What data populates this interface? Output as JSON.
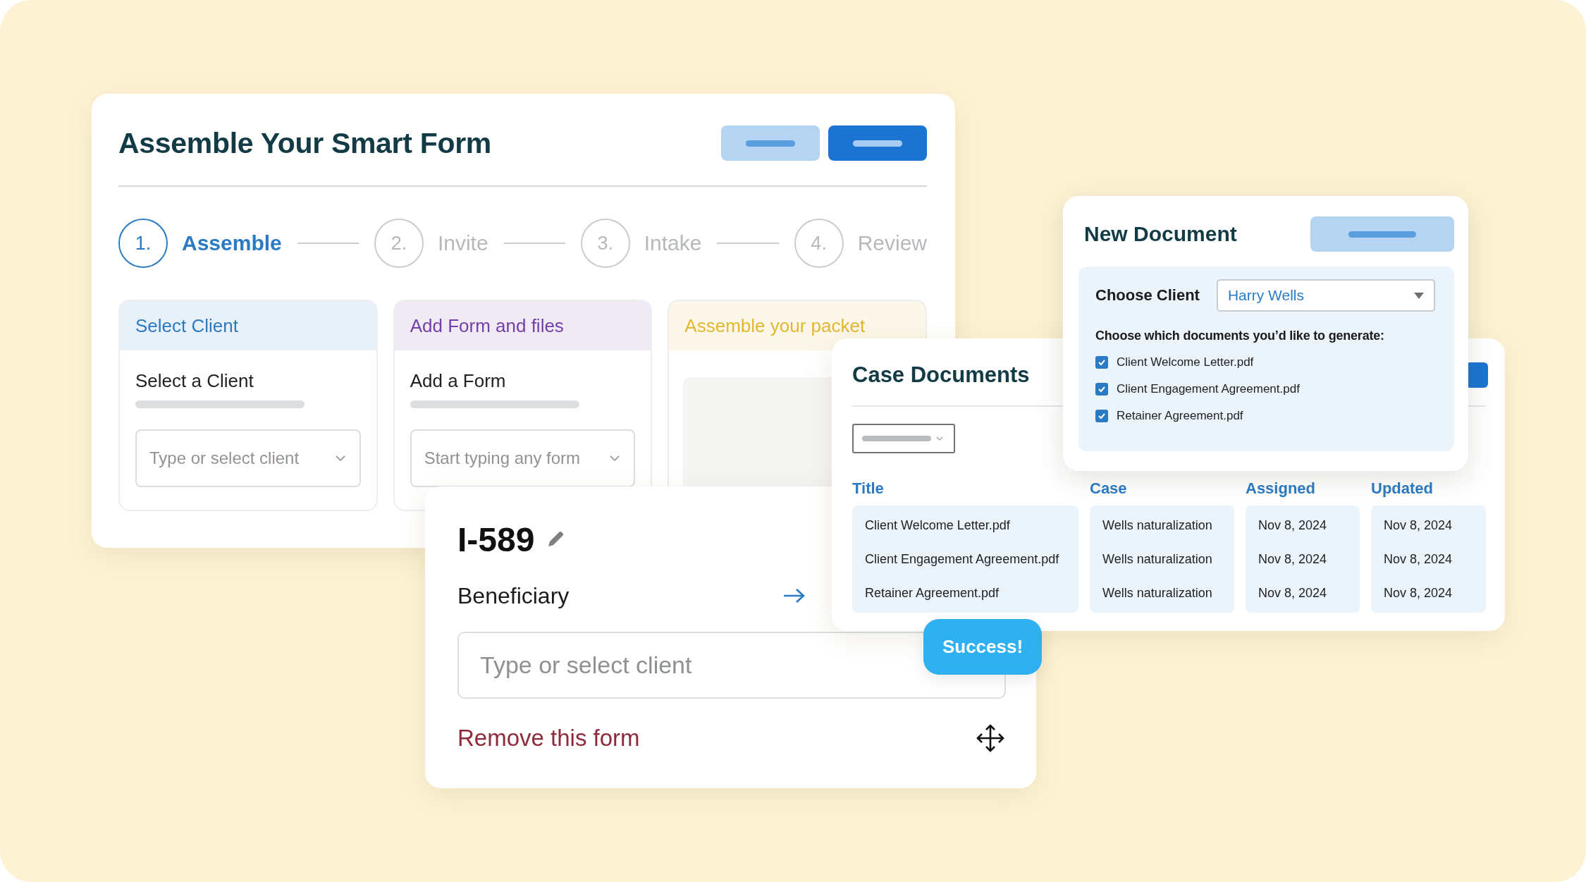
{
  "assemble_card": {
    "title": "Assemble Your Smart Form",
    "steps": [
      {
        "number": "1.",
        "label": "Assemble",
        "selected": true
      },
      {
        "number": "2.",
        "label": "Invite",
        "selected": false
      },
      {
        "number": "3.",
        "label": "Intake",
        "selected": false
      },
      {
        "number": "4.",
        "label": "Review",
        "selected": false
      }
    ],
    "panels": [
      {
        "kind": "field",
        "title": "Select Client",
        "color": "#2b7bc4",
        "label": "Select a Client",
        "placeholder": "Type or select client"
      },
      {
        "kind": "field",
        "title": "Add Form and files",
        "color": "#7440a8",
        "label": "Add a Form",
        "placeholder": "Start typing any form"
      },
      {
        "kind": "packet",
        "title": "Assemble your packet",
        "color": "#e2b833"
      }
    ]
  },
  "form_card": {
    "title": "I-589",
    "field_label": "Beneficiary",
    "placeholder": "Type or select client",
    "remove": "Remove this form"
  },
  "case_documents": {
    "title": "Case Documents",
    "columns": [
      "Title",
      "Case",
      "Assigned",
      "Updated"
    ],
    "rows": [
      {
        "title": "Client Welcome Letter.pdf",
        "case": "Wells naturalization",
        "assigned": "Nov 8, 2024",
        "updated": "Nov 8, 2024"
      },
      {
        "title": "Client Engagement Agreement.pdf",
        "case": "Wells naturalization",
        "assigned": "Nov 8, 2024",
        "updated": "Nov 8, 2024"
      },
      {
        "title": "Retainer Agreement.pdf",
        "case": "Wells naturalization",
        "assigned": "Nov 8, 2024",
        "updated": "Nov 8, 2024"
      }
    ]
  },
  "new_document": {
    "title": "New Document",
    "client_label": "Choose Client",
    "client": "Harry Wells",
    "prompt": "Choose which documents you’d like to generate:",
    "documents": [
      {
        "name": "Client Welcome Letter.pdf",
        "checked": true
      },
      {
        "name": "Client Engagement Agreement.pdf",
        "checked": true
      },
      {
        "name": "Retainer Agreement.pdf",
        "checked": true
      }
    ]
  },
  "toast": "Success!"
}
